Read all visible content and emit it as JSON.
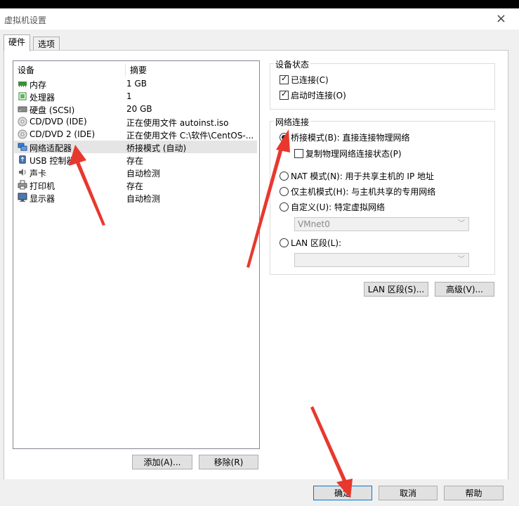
{
  "window": {
    "title": "虚拟机设置",
    "close_symbol": "×"
  },
  "tabs": [
    {
      "label": "硬件"
    },
    {
      "label": "选项"
    }
  ],
  "device_list": {
    "col_device": "设备",
    "col_summary": "摘要",
    "rows": [
      {
        "name": "内存",
        "summary": "1 GB",
        "icon": "memory-icon"
      },
      {
        "name": "处理器",
        "summary": "1",
        "icon": "processor-icon"
      },
      {
        "name": "硬盘 (SCSI)",
        "summary": "20 GB",
        "icon": "harddisk-icon"
      },
      {
        "name": "CD/DVD (IDE)",
        "summary": "正在使用文件 autoinst.iso",
        "icon": "cd-icon"
      },
      {
        "name": "CD/DVD 2 (IDE)",
        "summary": "正在使用文件 C:\\软件\\CentOS-...",
        "icon": "cd-icon"
      },
      {
        "name": "网络适配器",
        "summary": "桥接模式 (自动)",
        "icon": "network-adapter-icon",
        "selected": true
      },
      {
        "name": "USB 控制器",
        "summary": "存在",
        "icon": "usb-icon"
      },
      {
        "name": "声卡",
        "summary": "自动检测",
        "icon": "sound-icon"
      },
      {
        "name": "打印机",
        "summary": "存在",
        "icon": "printer-icon"
      },
      {
        "name": "显示器",
        "summary": "自动检测",
        "icon": "display-icon"
      }
    ],
    "add_button": "添加(A)...",
    "remove_button": "移除(R)"
  },
  "device_status": {
    "title": "设备状态",
    "connected": {
      "label": "已连接(C)",
      "checked": true
    },
    "connect_at_power_on": {
      "label": "启动时连接(O)",
      "checked": true
    }
  },
  "network": {
    "title": "网络连接",
    "bridged": {
      "label": "桥接模式(B): 直接连接物理网络",
      "selected": true
    },
    "replicate": {
      "label": "复制物理网络连接状态(P)",
      "checked": false
    },
    "nat": {
      "label": "NAT 模式(N): 用于共享主机的 IP 地址"
    },
    "host_only": {
      "label": "仅主机模式(H): 与主机共享的专用网络"
    },
    "custom": {
      "label": "自定义(U): 特定虚拟网络"
    },
    "custom_select": "VMnet0",
    "lan_segment": {
      "label": "LAN 区段(L):"
    },
    "lan_select": "",
    "lan_segments_button": "LAN 区段(S)...",
    "advanced_button": "高级(V)..."
  },
  "footer": {
    "ok": "确定",
    "cancel": "取消",
    "help": "帮助"
  },
  "colors": {
    "arrow": "#e8382e",
    "selection": "#e5e5e5",
    "ok_border": "#0078d7"
  }
}
